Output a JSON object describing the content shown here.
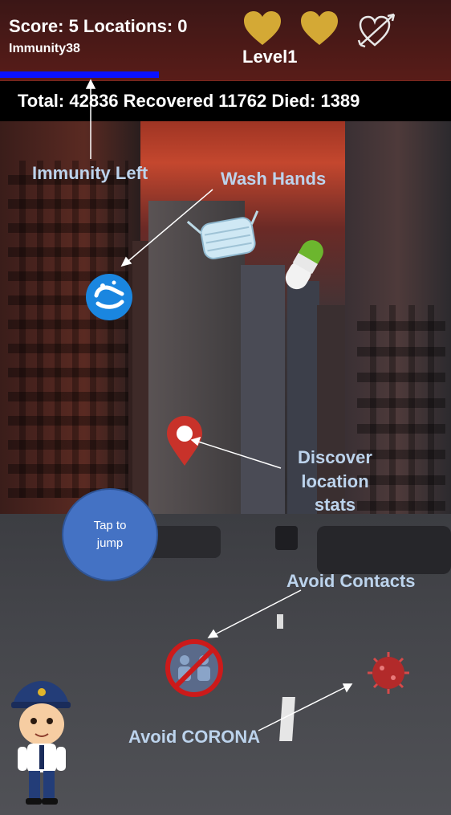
{
  "hud": {
    "score_text": "Score: 5 Locations: 0",
    "immunity_text": "Immunity38",
    "immunity_level": 0.38,
    "level_text": "Level1",
    "lives_icons": [
      "heart-icon",
      "heart-icon",
      "heart-arrow-icon"
    ]
  },
  "stats": {
    "text": "Total: 42836 Recovered 11762 Died: 1389"
  },
  "annotations": {
    "immunity_left": "Immunity Left",
    "wash_hands": "Wash Hands",
    "discover_line1": "Discover",
    "discover_line2": "location",
    "discover_line3": "stats",
    "avoid_contacts": "Avoid Contacts",
    "avoid_corona": "Avoid CORONA"
  },
  "controls": {
    "jump_line1": "Tap to",
    "jump_line2": "jump"
  },
  "colors": {
    "heart": "#d4a935",
    "immunity_bar": "#0a12ff",
    "stats_bar": "#000000",
    "annotation_text": "#bcd3ec",
    "jump_button": "#4472c4",
    "location_pin": "#c8322a",
    "wash_icon": "#1a86e0",
    "no_contact_sign": "#cc1a1a",
    "virus": "#b22a2a"
  },
  "game_items": [
    "wash-hands-icon",
    "mask-icon",
    "pill-icon",
    "location-pin-icon",
    "no-contact-icon",
    "coronavirus-icon",
    "police-character"
  ]
}
